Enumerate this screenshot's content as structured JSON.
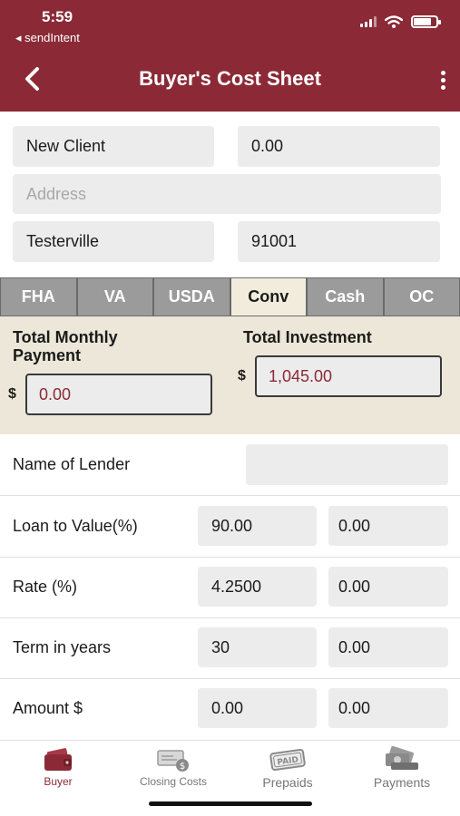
{
  "status_bar": {
    "time": "5:59",
    "back_app": "◂ sendIntent"
  },
  "header": {
    "title": "Buyer's Cost Sheet"
  },
  "client": {
    "name": "New Client",
    "price": "0.00",
    "address_placeholder": "Address",
    "city": "Testerville",
    "zip": "91001"
  },
  "tabs": [
    {
      "label": "FHA",
      "active": false
    },
    {
      "label": "VA",
      "active": false
    },
    {
      "label": "USDA",
      "active": false
    },
    {
      "label": "Conv",
      "active": true
    },
    {
      "label": "Cash",
      "active": false
    },
    {
      "label": "OC",
      "active": false
    }
  ],
  "summary": {
    "monthly_label_line1": "Total Monthly",
    "monthly_label_line2": "Payment",
    "monthly_value": "0.00",
    "investment_label": "Total Investment",
    "investment_value": "1,045.00",
    "currency": "$"
  },
  "loan": {
    "lender_label": "Name of Lender",
    "lender_value": "",
    "rows": [
      {
        "label": "Loan to Value(%)",
        "value1": "90.00",
        "value2": "0.00"
      },
      {
        "label": "Rate (%)",
        "value1": "4.2500",
        "value2": "0.00"
      },
      {
        "label": "Term in years",
        "value1": "30",
        "value2": "0.00"
      },
      {
        "label": "Amount $",
        "value1": "0.00",
        "value2": "0.00"
      }
    ]
  },
  "bottom_nav": [
    {
      "label": "Buyer",
      "icon": "wallet-icon",
      "active": true
    },
    {
      "label": "Closing Costs",
      "icon": "check-money-icon",
      "active": false
    },
    {
      "label": "Prepaids",
      "icon": "paid-stamp-icon",
      "active": false
    },
    {
      "label": "Payments",
      "icon": "cash-stack-icon",
      "active": false
    }
  ],
  "colors": {
    "brand": "#8b2a36",
    "summary_bg": "#ece7d8",
    "active_tab": "#f1ecdc"
  }
}
